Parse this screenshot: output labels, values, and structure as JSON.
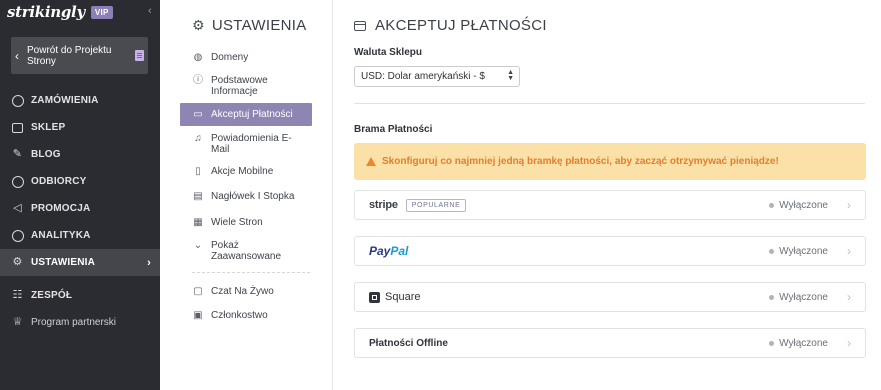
{
  "sidebar": {
    "logo": "strikingly",
    "badge": "VIP",
    "collapse_icon": "‹",
    "back_button": {
      "label": "Powrót do Projektu Strony",
      "icon": "chevron-left-icon"
    },
    "items": [
      {
        "label": "ZAMÓWIENIA",
        "icon": "dollar-circle-icon"
      },
      {
        "label": "SKLEP",
        "icon": "store-icon"
      },
      {
        "label": "BLOG",
        "icon": "pen-icon"
      },
      {
        "label": "ODBIORCY",
        "icon": "users-icon"
      },
      {
        "label": "PROMOCJA",
        "icon": "megaphone-icon"
      },
      {
        "label": "ANALITYKA",
        "icon": "pie-chart-icon"
      },
      {
        "label": "USTAWIENIA",
        "icon": "gear-icon",
        "active": true
      },
      {
        "label": "ZESPÓŁ",
        "icon": "team-icon"
      },
      {
        "label": "Program partnerski",
        "icon": "trophy-icon"
      }
    ]
  },
  "settings_menu": {
    "title": "USTAWIENIA",
    "items": [
      {
        "label": "Domeny",
        "icon": "globe-icon"
      },
      {
        "label": "Podstawowe Informacje",
        "icon": "info-icon"
      },
      {
        "label": "Akceptuj Płatności",
        "icon": "credit-card-icon",
        "active": true
      },
      {
        "label": "Powiadomienia E-Mail",
        "icon": "bell-icon"
      },
      {
        "label": "Akcje Mobilne",
        "icon": "mobile-icon"
      },
      {
        "label": "Nagłówek I Stopka",
        "icon": "layout-icon"
      },
      {
        "label": "Wiele Stron",
        "icon": "pages-icon"
      },
      {
        "label": "Pokaż Zaawansowane",
        "icon": "chevron-down-icon"
      },
      {
        "label": "Czat Na Żywo",
        "icon": "chat-icon"
      },
      {
        "label": "Członkostwo",
        "icon": "member-icon"
      }
    ]
  },
  "main": {
    "title": "AKCEPTUJ PŁATNOŚCI",
    "currency_label": "Waluta Sklepu",
    "currency_value": "USD: Dolar amerykański - $",
    "gateway_label": "Brama Płatności",
    "warning": "Skonfiguruj co najmniej jedną bramkę płatności, aby zacząć otrzymywać pieniądze!",
    "gateways": [
      {
        "name": "stripe",
        "badge": "POPULARNE",
        "status": "Wyłączone"
      },
      {
        "name_pay": "Pay",
        "name_pal": "Pal",
        "status": "Wyłączone"
      },
      {
        "name": "Square",
        "status": "Wyłączone"
      },
      {
        "name": "Płatności Offline",
        "status": "Wyłączone"
      }
    ]
  },
  "colors": {
    "sidebar_bg": "#2b2c31",
    "accent": "#8e85b3",
    "warning_bg": "#fbe0a8",
    "warning_text": "#e27f2c"
  }
}
